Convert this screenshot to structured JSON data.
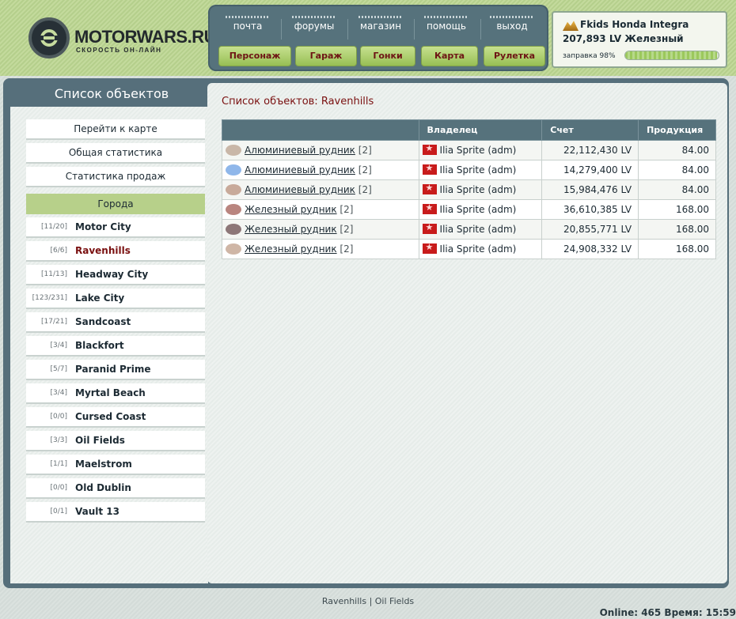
{
  "brand": {
    "title": "MOTORWARS.RU",
    "subtitle": "СКОРОСТЬ ОН-ЛАЙН"
  },
  "nav": {
    "links": [
      "почта",
      "форумы",
      "магазин",
      "помощь",
      "выход"
    ],
    "buttons": [
      "Персонаж",
      "Гараж",
      "Гонки",
      "Карта",
      "Рулетка"
    ]
  },
  "car": {
    "name": "Fkids Honda Integra",
    "money": "207,893 LV Железный",
    "fuel_label": "заправка 98%",
    "fuel_level": 0.98
  },
  "sidebar": {
    "title": "Список объектов",
    "buttons": [
      "Перейти к карте",
      "Общая статистика",
      "Статистика продаж"
    ],
    "section": "Города",
    "cities": [
      {
        "count": "[11/20]",
        "name": "Motor City"
      },
      {
        "count": "[6/6]",
        "name": "Ravenhills",
        "active": true
      },
      {
        "count": "[11/13]",
        "name": "Headway City"
      },
      {
        "count": "[123/231]",
        "name": "Lake City"
      },
      {
        "count": "[17/21]",
        "name": "Sandcoast"
      },
      {
        "count": "[3/4]",
        "name": "Blackfort"
      },
      {
        "count": "[5/7]",
        "name": "Paranid Prime"
      },
      {
        "count": "[3/4]",
        "name": "Myrtal Beach"
      },
      {
        "count": "[0/0]",
        "name": "Cursed Coast"
      },
      {
        "count": "[3/3]",
        "name": "Oil Fields"
      },
      {
        "count": "[1/1]",
        "name": "Maelstrom"
      },
      {
        "count": "[0/0]",
        "name": "Old Dublin"
      },
      {
        "count": "[0/1]",
        "name": "Vault 13"
      }
    ]
  },
  "list": {
    "title": "Список объектов: Ravenhills",
    "headers": [
      "",
      "Владелец",
      "Счет",
      "Продукция"
    ],
    "rows": [
      {
        "object": "Алюминиевый рудник",
        "level": "[2]",
        "owner": "Ilia Sprite (adm)",
        "account": "22,112,430 LV",
        "production": "84.00",
        "icon_color": "#c9b7a8"
      },
      {
        "object": "Алюминиевый рудник",
        "level": "[2]",
        "owner": "Ilia Sprite (adm)",
        "account": "14,279,400 LV",
        "production": "84.00",
        "icon_color": "#8fb7ea"
      },
      {
        "object": "Алюминиевый рудник",
        "level": "[2]",
        "owner": "Ilia Sprite (adm)",
        "account": "15,984,476 LV",
        "production": "84.00",
        "icon_color": "#c8aa9a"
      },
      {
        "object": "Железный рудник",
        "level": "[2]",
        "owner": "Ilia Sprite (adm)",
        "account": "36,610,385 LV",
        "production": "168.00",
        "icon_color": "#b9857f"
      },
      {
        "object": "Железный рудник",
        "level": "[2]",
        "owner": "Ilia Sprite (adm)",
        "account": "20,855,771 LV",
        "production": "168.00",
        "icon_color": "#8d7778"
      },
      {
        "object": "Железный рудник",
        "level": "[2]",
        "owner": "Ilia Sprite (adm)",
        "account": "24,908,332 LV",
        "production": "168.00",
        "icon_color": "#cfb6a6"
      }
    ]
  },
  "footer": {
    "links": "Ravenhills | Oil Fields",
    "status": "Online: 465  Время: 15:59"
  }
}
